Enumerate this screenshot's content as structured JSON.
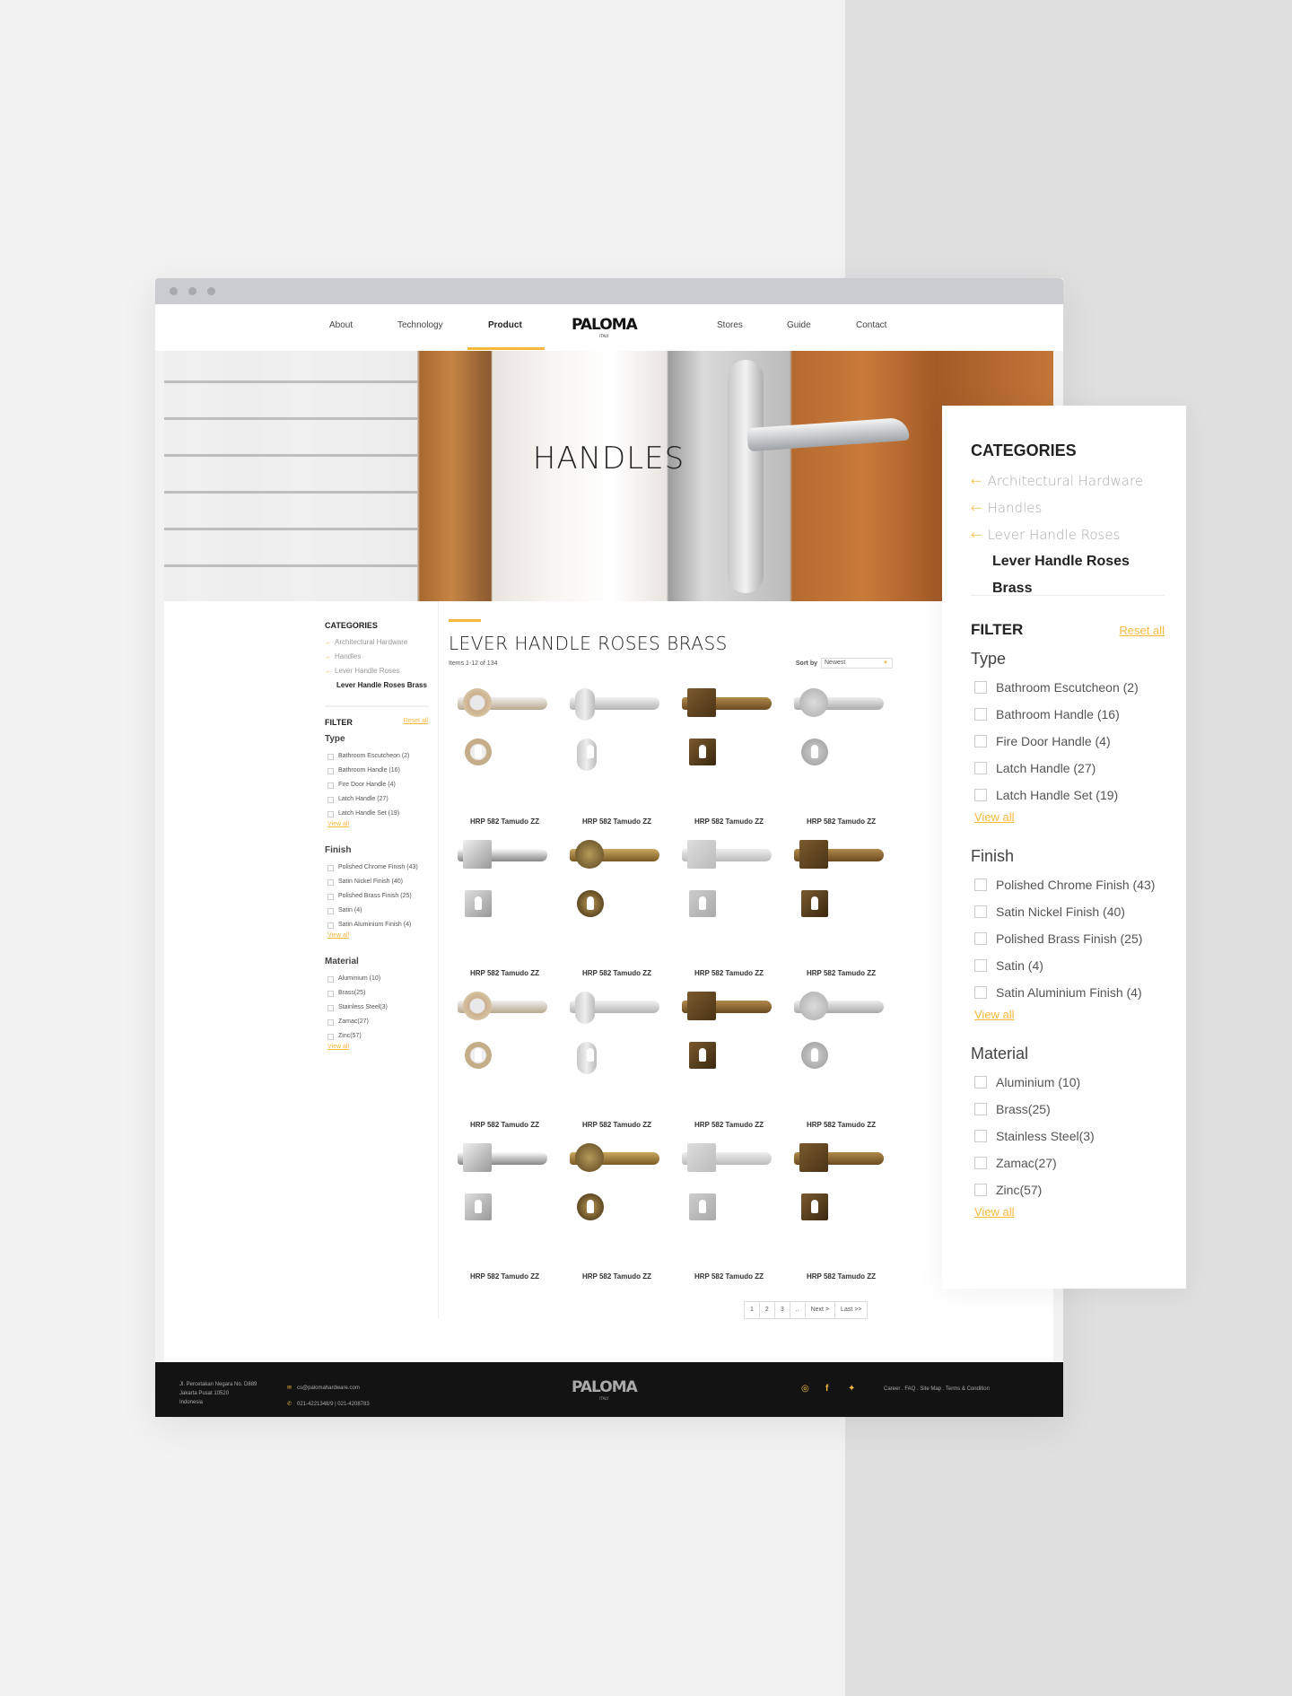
{
  "nav": {
    "items": [
      "About",
      "Technology",
      "Product",
      "Stores",
      "Guide",
      "Contact"
    ],
    "active": "Product",
    "logo": "PALOMA",
    "logo_sub": "ITALY"
  },
  "hero": {
    "title": "HANDLES"
  },
  "categories": {
    "title": "CATEGORIES",
    "items": [
      "Architectural Hardware",
      "Handles",
      "Lever Handle Roses"
    ],
    "current": "Lever Handle Roses Brass"
  },
  "filter": {
    "title": "FILTER",
    "reset": "Reset all",
    "view_all": "View all",
    "groups": [
      {
        "name": "Type",
        "options": [
          "Bathroom Escutcheon (2)",
          "Bathroom Handle (16)",
          "Fire Door Handle (4)",
          "Latch Handle (27)",
          "Latch Handle Set (19)"
        ]
      },
      {
        "name": "Finish",
        "options": [
          "Polished Chrome Finish (43)",
          "Satin Nickel Finish (40)",
          "Polished Brass Finish (25)",
          "Satin (4)",
          "Satin Aluminium Finish (4)"
        ]
      },
      {
        "name": "Material",
        "options": [
          "Aluminium (10)",
          "Brass(25)",
          "Stainless Steel(3)",
          "Zamac(27)",
          "Zinc(57)"
        ]
      }
    ]
  },
  "listing": {
    "title": "LEVER HANDLE ROSES BRASS",
    "count": "Items 1-12 of 134",
    "sort_label": "Sort by",
    "sort_value": "Newest"
  },
  "products": [
    {
      "name": "HRP 582 Tamudo ZZ",
      "finish": "chrome-brass"
    },
    {
      "name": "HRP 582 Tamudo ZZ",
      "finish": "satin-oval"
    },
    {
      "name": "HRP 582 Tamudo ZZ",
      "finish": "bronze-square"
    },
    {
      "name": "HRP 582 Tamudo ZZ",
      "finish": "satin"
    },
    {
      "name": "HRP 582 Tamudo ZZ",
      "finish": "chrome-square"
    },
    {
      "name": "HRP 582 Tamudo ZZ",
      "finish": "antique-brass"
    },
    {
      "name": "HRP 582 Tamudo ZZ",
      "finish": "satin-square"
    },
    {
      "name": "HRP 582 Tamudo ZZ",
      "finish": "bronze-square"
    },
    {
      "name": "HRP 582 Tamudo ZZ",
      "finish": "chrome-brass"
    },
    {
      "name": "HRP 582 Tamudo ZZ",
      "finish": "satin-oval"
    },
    {
      "name": "HRP 582 Tamudo ZZ",
      "finish": "bronze-square"
    },
    {
      "name": "HRP 582 Tamudo ZZ",
      "finish": "satin"
    },
    {
      "name": "HRP 582 Tamudo ZZ",
      "finish": "chrome-square"
    },
    {
      "name": "HRP 582 Tamudo ZZ",
      "finish": "antique-brass"
    },
    {
      "name": "HRP 582 Tamudo ZZ",
      "finish": "satin-square"
    },
    {
      "name": "HRP 582 Tamudo ZZ",
      "finish": "bronze-square"
    }
  ],
  "pagination": [
    "1",
    "2",
    "3",
    "..",
    "Next >",
    "Last >>"
  ],
  "footer": {
    "address": [
      "Jl. Percetakan Negara No. D889",
      "Jakarta Pusat 10520",
      "Indonesia"
    ],
    "email": "cs@palomahardware.com",
    "phone": "021-4221348/9  |  021-4208783",
    "links": "Career  .  FAQ  .  Site Map  .  Terms & Condition",
    "social": [
      "instagram-icon",
      "facebook-icon",
      "twitter-icon"
    ]
  },
  "colors": {
    "accent": "#f5b83d",
    "footer": "#131313"
  }
}
